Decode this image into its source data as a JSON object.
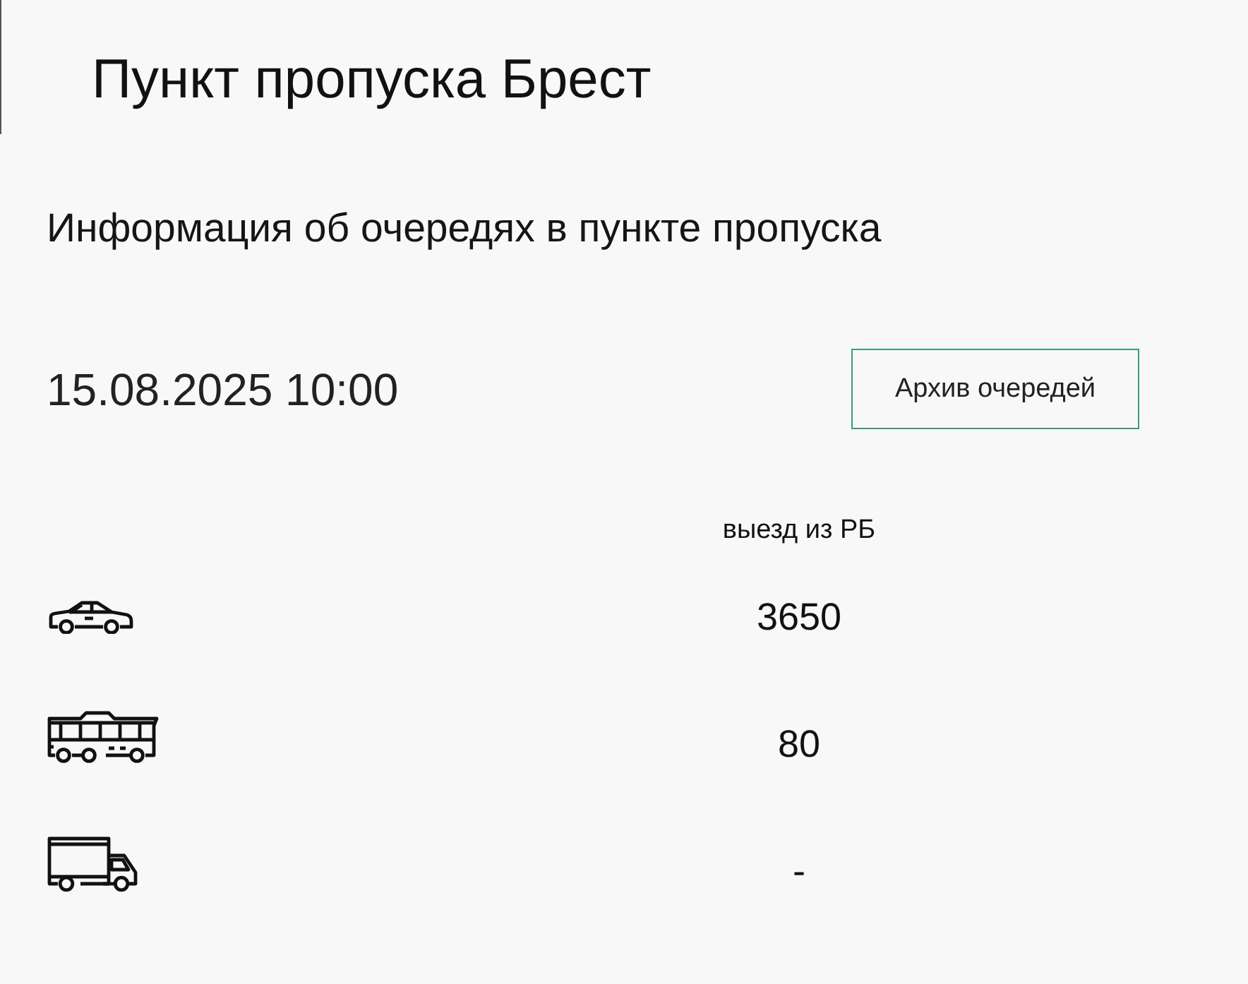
{
  "header": {
    "title": "Пункт пропуска Брест"
  },
  "subtitle": "Информация об очередях в пункте пропуска",
  "timestamp": "15.08.2025 10:00",
  "archive_button": {
    "label": "Архив очередей"
  },
  "table": {
    "columns": [
      "выезд из РБ"
    ],
    "rows": [
      {
        "kind": "car",
        "value": "3650"
      },
      {
        "kind": "bus",
        "value": "80"
      },
      {
        "kind": "truck",
        "value": "-"
      }
    ]
  }
}
